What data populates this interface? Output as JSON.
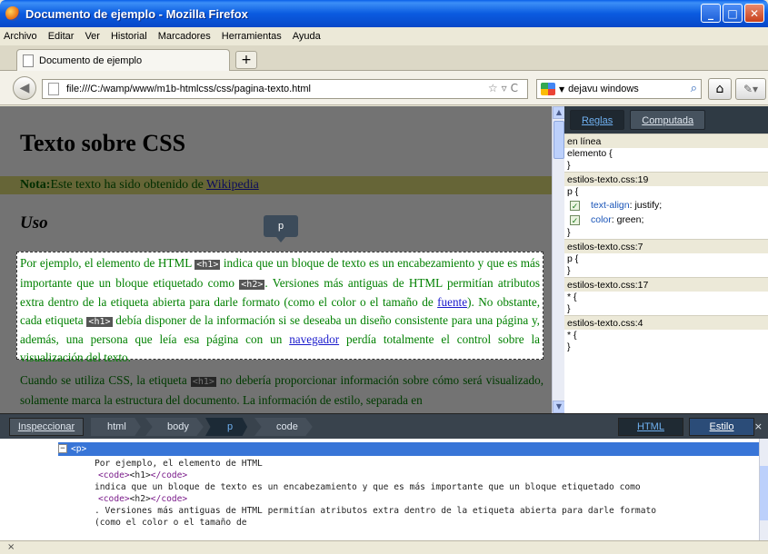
{
  "window": {
    "title": "Documento de ejemplo - Mozilla Firefox"
  },
  "menu": [
    "Archivo",
    "Editar",
    "Ver",
    "Historial",
    "Marcadores",
    "Herramientas",
    "Ayuda"
  ],
  "tab": {
    "title": "Documento de ejemplo",
    "new_tab": "+"
  },
  "nav": {
    "url": "file:///C:/wamp/www/m1b-htmlcss/css/pagina-texto.html",
    "search_value": "dejavu windows"
  },
  "page": {
    "h1": "Texto sobre CSS",
    "nota_label": "Nota:",
    "nota_text": "Este texto ha sido obtenido de ",
    "nota_link": "Wikipedia",
    "h2": "Uso",
    "tooltip": "p",
    "p1": {
      "t1": "Por ejemplo, el elemento de HTML ",
      "code1": "<h1>",
      "t2": " indica que un bloque de texto es un encabezamiento y que es más importante que un bloque etiquetado como ",
      "code2": "<h2>",
      "t3": ". Versiones más antiguas de HTML permitían atributos extra dentro de la etiqueta abierta para darle formato (como el color o el tamaño de ",
      "link1": "fuente",
      "t4": "). No obstante, cada etiqueta ",
      "code3": "<h1>",
      "t5": " debía disponer de la información si se deseaba un diseño consistente para una página y, además, una persona que leía esa página con un ",
      "link2": "navegador",
      "t6": " perdía totalmente el control sobre la visualización del texto."
    },
    "p2": {
      "t1": "Cuando se utiliza CSS, la etiqueta ",
      "code1": "<h1>",
      "t2": " no debería proporcionar información sobre cómo será visualizado, solamente marca la estructura del documento. La información de estilo, separada en"
    }
  },
  "style_panel": {
    "tab_rules": "Reglas",
    "tab_computed": "Computada",
    "sections": {
      "inline_head": "en línea",
      "inline_rule": "elemento {",
      "close": "}",
      "s1_head": "estilos-texto.css:19",
      "s1_selector": "p {",
      "s1_decl1_prop": "text-align",
      "s1_decl1_val": ": justify;",
      "s1_decl2_prop": "color",
      "s1_decl2_val": ": green;",
      "s2_head": "estilos-texto.css:7",
      "s2_selector": "p {",
      "s3_head": "estilos-texto.css:17",
      "s3_selector": "* {",
      "s4_head": "estilos-texto.css:4",
      "s4_selector": "* {"
    }
  },
  "inspector": {
    "inspect_button": "Inspeccionar",
    "breadcrumbs": [
      "html",
      "body",
      "p",
      "code"
    ],
    "html_button": "HTML",
    "style_button": "Estilo",
    "close": "×"
  },
  "html_panel": {
    "selected_node": "<p>",
    "twisty": "−",
    "lines": [
      "Por ejemplo, el elemento de HTML",
      "indica que un bloque de texto es un encabezamiento y que es más importante que un bloque etiquetado como",
      ". Versiones más antiguas de HTML permitían atributos extra dentro de la etiqueta abierta para darle formato",
      "(como el color o el tamaño de"
    ],
    "code_open": "<code>",
    "code_close": "</code>",
    "code_text1": "<h1>",
    "code_text2": "<h2>"
  },
  "status": {
    "close": "×"
  }
}
